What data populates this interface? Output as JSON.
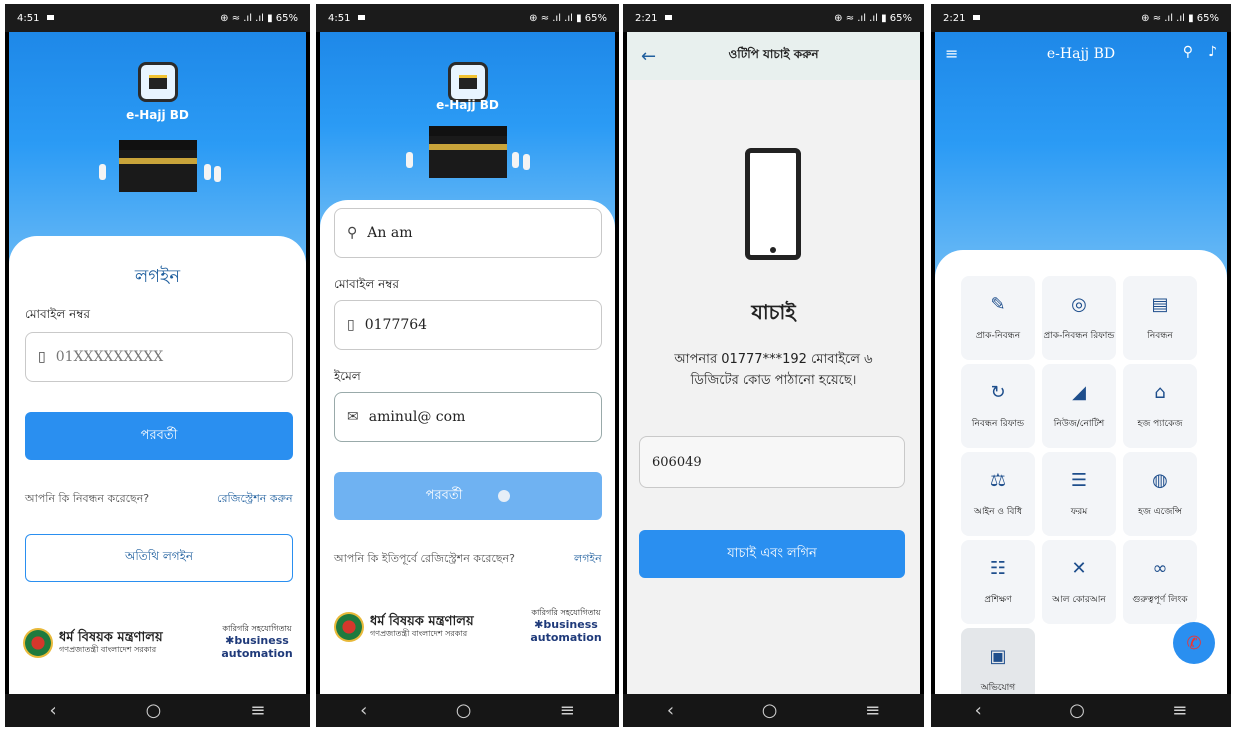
{
  "screens": {
    "login": {
      "status": {
        "time": "4:51",
        "battery": "65%"
      },
      "brand": "e-Hajj BD",
      "title": "লগইন",
      "mobile_label": "মোবাইল নম্বর",
      "mobile_placeholder": "01XXXXXXXXX",
      "next_button": "পরবর্তী",
      "registered_question": "আপনি কি নিবন্ধন করেছেন?",
      "register_link": "রেজিস্ট্রেশন করুন",
      "guest_login_button": "অতিথি লগইন",
      "ministry": "ধর্ম বিষয়ক মন্ত্রণালয়",
      "govt": "গণপ্রজাতন্ত্রী বাংলাদেশ সরকার",
      "tech_support": "কারিগরি সহযোগিতায়",
      "company_top": "business",
      "company_bottom": "automation"
    },
    "register": {
      "status": {
        "time": "4:51",
        "battery": "65%"
      },
      "brand": "e-Hajj BD",
      "name_value": "An         am",
      "mobile_label": "মোবাইল নম্বর",
      "mobile_value": "0177764",
      "email_label": "ইমেল",
      "email_value": "aminul@        com",
      "next_button": "পরবর্তী",
      "already_question": "আপনি কি ইতিপূর্বে রেজিস্ট্রেশন করেছেন?",
      "login_link": "লগইন",
      "ministry": "ধর্ম বিষয়ক মন্ত্রণালয়",
      "govt": "গণপ্রজাতন্ত্রী বাংলাদেশ সরকার",
      "tech_support": "কারিগরি সহযোগিতায়",
      "company_top": "business",
      "company_bottom": "automation"
    },
    "otp": {
      "status": {
        "time": "2:21",
        "battery": "65%"
      },
      "appbar_title": "ওটিপি যাচাই করুন",
      "heading": "যাচাই",
      "message_line1": "আপনার 01777***192 মোবাইলে ৬",
      "message_line2": "ডিজিটের কোড পাঠানো হয়েছে।",
      "code_value": "606049",
      "verify_button": "যাচাই এবং লগিন"
    },
    "home": {
      "status": {
        "time": "2:21",
        "battery": "65%"
      },
      "brand": "e-Hajj BD",
      "tiles": [
        {
          "label": "প্রাক-নিবন্ধন",
          "icon": "edit-doc-icon"
        },
        {
          "label": "প্রাক-নিবন্ধন রিফান্ড",
          "icon": "refund-coin-icon"
        },
        {
          "label": "নিবন্ধন",
          "icon": "id-card-icon"
        },
        {
          "label": "নিবন্ধন রিফান্ড",
          "icon": "refund-cycle-icon"
        },
        {
          "label": "নিউজ/নোটিশ",
          "icon": "megaphone-icon"
        },
        {
          "label": "হজ প্যাকেজ",
          "icon": "house-icon"
        },
        {
          "label": "আইন ও বিধি",
          "icon": "scale-icon"
        },
        {
          "label": "ফরম",
          "icon": "form-icon"
        },
        {
          "label": "হজ এজেন্সি",
          "icon": "agency-globe-icon"
        },
        {
          "label": "প্রশিক্ষণ",
          "icon": "training-icon"
        },
        {
          "label": "আল কোরআন",
          "icon": "quran-icon"
        },
        {
          "label": "গুরুত্বপূর্ণ লিংক",
          "icon": "link-icon"
        },
        {
          "label": "অভিযোগ",
          "icon": "complaint-icon"
        }
      ]
    }
  },
  "colors": {
    "primary": "#2a8ff0",
    "hero_top": "#1e88e8",
    "link": "#1f5f9e"
  }
}
